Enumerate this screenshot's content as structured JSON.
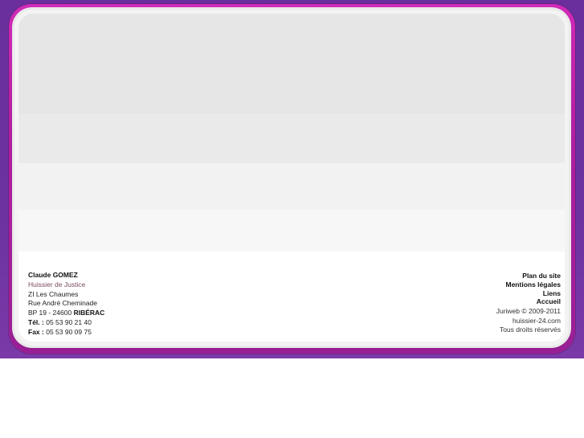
{
  "contact": {
    "name": "Claude GOMEZ",
    "title": "Huissier de Justice",
    "address_line1": "ZI Les Chaumes",
    "address_line2": "Rue André Cheminade",
    "postal_prefix": "BP 19 - 24600",
    "city": "RIBÉRAC",
    "phone_label": "Tél. :",
    "phone": "05 53 90 21 40",
    "fax_label": "Fax :",
    "fax": "05 53 90 09 75"
  },
  "footer_links": {
    "sitemap": "Plan du site",
    "legal": "Mentions légales",
    "links": "Liens",
    "home": "Accueil"
  },
  "credits": {
    "copyright": "Juriweb © 2009-2011",
    "domain": "huissier-24.com",
    "rights": "Tous droits réservés"
  },
  "colors": {
    "outer_frame": "#6a2f9c",
    "card_border": "#c524ad",
    "background": "#ffffff"
  }
}
